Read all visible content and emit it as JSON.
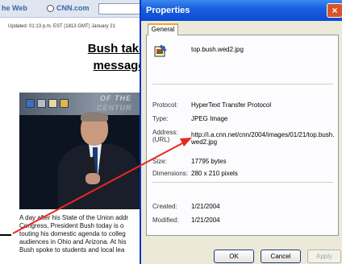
{
  "webpage": {
    "search_bar": {
      "web_label": "he Web",
      "cnn_label": "CNN.com"
    },
    "updated_text": "Updated: 01:13 p.m. EST (1813 GMT) January 21",
    "headline": {
      "line1": "Bush takes State of",
      "line2": "message on the ro"
    },
    "photo": {
      "banner_line1": "OF THE",
      "banner_line2": "CENTUR"
    },
    "body_lines": [
      "A day after his State of the Union addr",
      "Congress, President Bush today is o",
      "touting his domestic agenda to colleg",
      "audiences in Ohio and Arizona. At his",
      "Bush spoke to students and local lea"
    ]
  },
  "dialog": {
    "title": "Properties",
    "close_glyph": "×",
    "tab_general": "General",
    "file_name": "top.bush.wed2.jpg",
    "fields": {
      "protocol": {
        "label": "Protocol:",
        "value": "HyperText Transfer Protocol"
      },
      "type": {
        "label": "Type:",
        "value": "JPEG Image"
      },
      "address": {
        "label_line1": "Address:",
        "label_line2": "(URL)",
        "value": "http://i.a.cnn.net/cnn/2004/images/01/21/top.bush.wed2.jpg"
      },
      "size": {
        "label": "Size:",
        "value": "17795 bytes"
      },
      "dimensions": {
        "label": "Dimensions:",
        "value": "280 x 210 pixels"
      },
      "created": {
        "label": "Created:",
        "value": "1/21/2004"
      },
      "modified": {
        "label": "Modified:",
        "value": "1/21/2004"
      }
    },
    "buttons": {
      "ok": "OK",
      "cancel": "Cancel",
      "apply": "Apply"
    }
  },
  "colors": {
    "title_bar": "#0a4bd4",
    "arrow": "#e8281e",
    "dialog_face": "#ece9d8"
  }
}
